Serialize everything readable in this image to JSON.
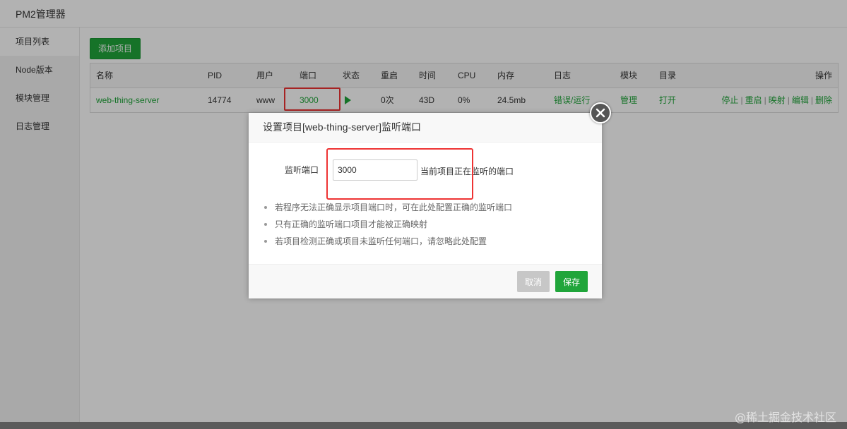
{
  "app": {
    "title": "PM2管理器"
  },
  "sidebar": {
    "items": [
      {
        "label": "项目列表",
        "active": true
      },
      {
        "label": "Node版本",
        "active": false
      },
      {
        "label": "模块管理",
        "active": false
      },
      {
        "label": "日志管理",
        "active": false
      }
    ]
  },
  "toolbar": {
    "add_label": "添加项目"
  },
  "table": {
    "headers": [
      "名称",
      "PID",
      "用户",
      "端口",
      "状态",
      "重启",
      "时间",
      "CPU",
      "内存",
      "日志",
      "模块",
      "目录",
      "操作"
    ],
    "rows": [
      {
        "name": "web-thing-server",
        "pid": "14774",
        "user": "www",
        "port": "3000",
        "status_icon": "play-icon",
        "restarts": "0次",
        "time": "43D",
        "cpu": "0%",
        "memory": "24.5mb",
        "log": "错误/运行",
        "module": "管理",
        "dir": "打开",
        "actions": [
          "停止",
          "重启",
          "映射",
          "编辑",
          "删除"
        ]
      }
    ]
  },
  "dialog": {
    "title": "设置项目[web-thing-server]监听端口",
    "field_label": "监听端口",
    "field_value": "3000",
    "field_hint": "当前项目正在监听的端口",
    "tips": [
      "若程序无法正确显示项目端口时，可在此处配置正确的监听端口",
      "只有正确的监听端口项目才能被正确映射",
      "若项目检测正确或项目未监听任何端口，请忽略此处配置"
    ],
    "cancel_label": "取消",
    "save_label": "保存"
  },
  "watermark": "@稀土掘金技术社区",
  "colors": {
    "accent": "#20a53a",
    "highlight": "#e33333",
    "overlay": "rgba(0,0,0,0.3)"
  }
}
